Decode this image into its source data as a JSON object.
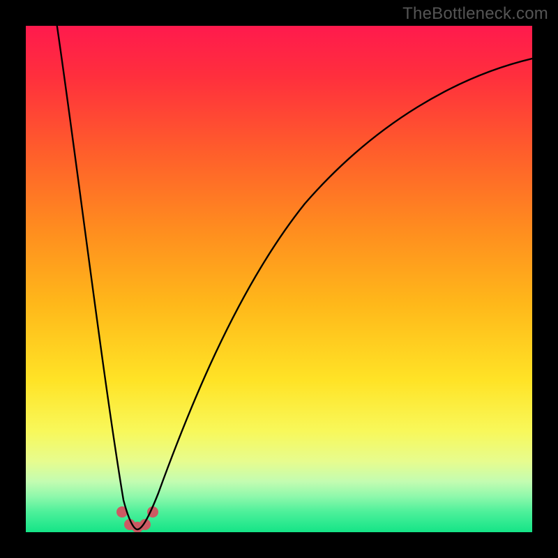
{
  "watermark": "TheBottleneck.com",
  "chart_data": {
    "type": "line",
    "title": "",
    "xlabel": "",
    "ylabel": "",
    "xlim": [
      0,
      100
    ],
    "ylim": [
      0,
      100
    ],
    "background": {
      "type": "vertical_gradient",
      "stops": [
        {
          "offset": 0.0,
          "color": "#ff1a4d"
        },
        {
          "offset": 0.1,
          "color": "#ff2f3d"
        },
        {
          "offset": 0.25,
          "color": "#ff5e2b"
        },
        {
          "offset": 0.4,
          "color": "#ff8c1f"
        },
        {
          "offset": 0.55,
          "color": "#ffb81a"
        },
        {
          "offset": 0.7,
          "color": "#ffe326"
        },
        {
          "offset": 0.8,
          "color": "#f8f85a"
        },
        {
          "offset": 0.86,
          "color": "#e7fc8e"
        },
        {
          "offset": 0.9,
          "color": "#c3fcb1"
        },
        {
          "offset": 0.93,
          "color": "#8df8ab"
        },
        {
          "offset": 0.96,
          "color": "#4df09a"
        },
        {
          "offset": 1.0,
          "color": "#14e487"
        }
      ]
    },
    "curve": {
      "description": "Bottleneck percentage vs. component balance; valley marks zero bottleneck",
      "min_at_x": 22,
      "color": "#000000",
      "stroke_width": 2
    },
    "markers": {
      "color": "#cc5a63",
      "radius": 8,
      "points_x": [
        19,
        20.5,
        22,
        23.5,
        25
      ],
      "points_y": [
        96,
        98.5,
        99,
        98.5,
        96
      ]
    }
  }
}
